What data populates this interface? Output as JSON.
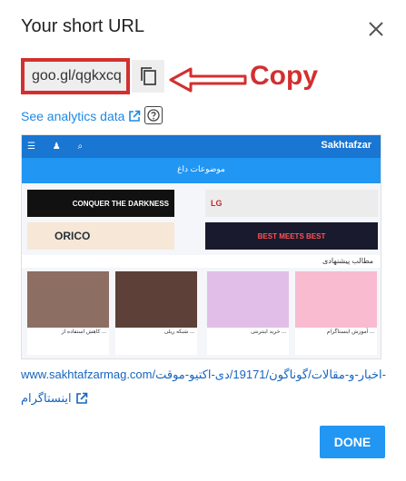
{
  "dialog": {
    "title": "Your short URL",
    "short_url": "goo.gl/qgkxcq",
    "annotation": "Copy",
    "analytics_label": "See analytics data",
    "link_line1": "www.sakhtafzarmag.com/اخبار-و-مقالات/گوناگون/19171/دی-اکتیو-موقت-",
    "link_line2": "اینستاگرام",
    "done_label": "DONE"
  },
  "preview": {
    "logo": "Sakhtafzar",
    "bar_title": "موضوعات داغ",
    "section_title": "مطالب پیشنهادی",
    "banners": [
      {
        "text": "CONQUER THE DARKNESS",
        "bg": "#111111",
        "fg": "#ffffff"
      },
      {
        "text": "LG",
        "bg": "#ececec",
        "fg": "#c62828"
      },
      {
        "text": "ORICO",
        "bg": "#f7e7d6",
        "fg": "#263238"
      },
      {
        "text": "BEST MEETS BEST",
        "bg": "#1a1a2e",
        "fg": "#ff5252"
      }
    ],
    "cards": [
      {
        "caption": "کاهش استفاده از ...",
        "color": "#8d6e63"
      },
      {
        "caption": "شبکه ریلی ...",
        "color": "#5d4037"
      },
      {
        "caption": "خرید اینترنتی ...",
        "color": "#e1bee7"
      },
      {
        "caption": "آموزش اینستاگرام ...",
        "color": "#f8bbd0"
      }
    ]
  },
  "colors": {
    "accent": "#2196f3",
    "annotation": "#d32f2f",
    "link": "#1565c0"
  }
}
